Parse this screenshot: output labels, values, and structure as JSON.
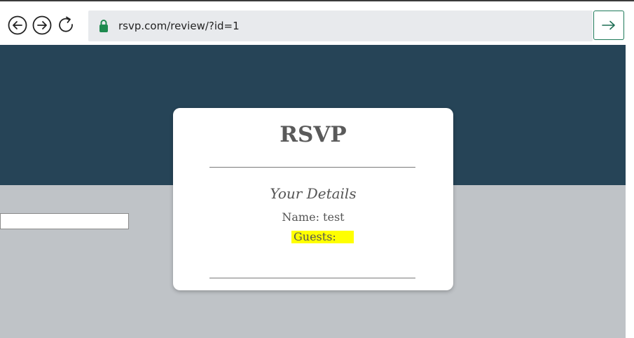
{
  "browser": {
    "url": "rsvp.com/review/?id=1",
    "back_icon": "back-arrow-icon",
    "forward_icon": "forward-arrow-icon",
    "reload_icon": "reload-icon",
    "lock_icon": "lock-icon",
    "go_icon": "arrow-right-icon"
  },
  "colors": {
    "hero": "#264457",
    "page_background": "#bfc3c7",
    "highlight": "#ffff00",
    "lock": "#1e8a4f"
  },
  "card": {
    "title": "RSVP",
    "details_heading": "Your Details",
    "name_line": "Name: test",
    "guests_line": "Guests:"
  },
  "side_input": {
    "value": ""
  }
}
